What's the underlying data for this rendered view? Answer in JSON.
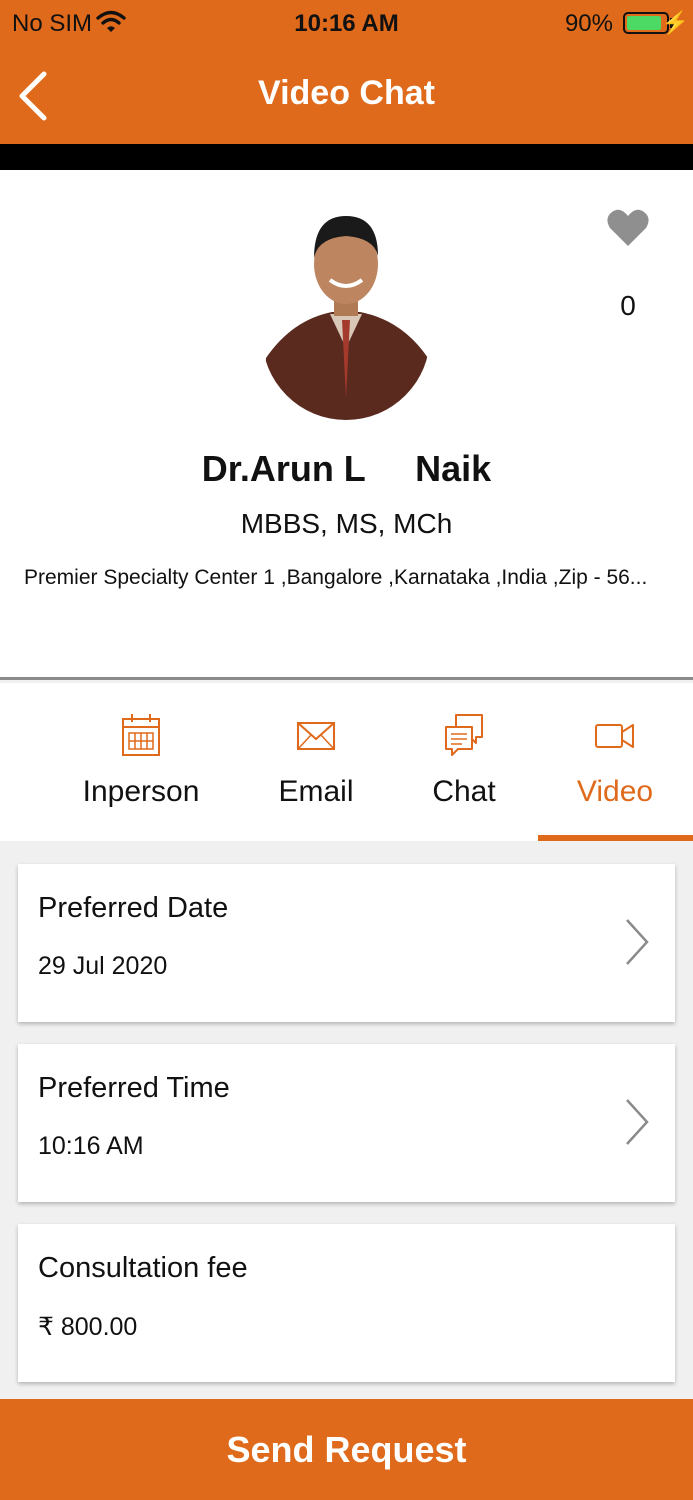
{
  "status_bar": {
    "carrier": "No SIM",
    "time": "10:16 AM",
    "battery": "90%"
  },
  "nav": {
    "title": "Video Chat"
  },
  "profile": {
    "name": "Dr.Arun L     Naik",
    "qualification": "MBBS, MS, MCh",
    "address": "Premier Specialty Center 1 ,Bangalore ,Karnataka ,India ,Zip -  56...",
    "likes": "0"
  },
  "tabs": [
    {
      "label": "Inperson",
      "icon": "calendar-icon"
    },
    {
      "label": "Email",
      "icon": "envelope-icon"
    },
    {
      "label": "Chat",
      "icon": "chat-bubbles-icon"
    },
    {
      "label": "Video",
      "icon": "video-camera-icon"
    }
  ],
  "active_tab": "Video",
  "cards": [
    {
      "title": "Preferred Date",
      "value": "29 Jul 2020"
    },
    {
      "title": "Preferred Time",
      "value": "10:16 AM"
    },
    {
      "title": "Consultation fee",
      "value": "₹ 800.00"
    }
  ],
  "send_button": "Send Request",
  "colors": {
    "accent": "#e06a1b",
    "battery": "#4cd964"
  }
}
